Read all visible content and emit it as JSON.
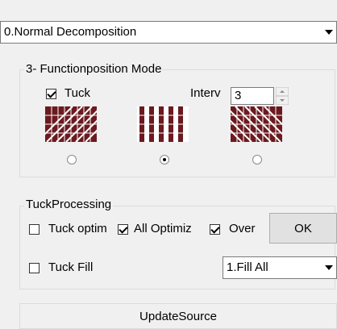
{
  "decomposition": {
    "selected": "0.Normal Decomposition"
  },
  "function_group": {
    "legend": "3- Functionposition Mode",
    "tuck_label": "Tuck",
    "tuck_checked": true,
    "interval_label": "Interv",
    "interval_value": "3",
    "patterns": [
      "diagonal-weave",
      "vertical-stripe",
      "reverse-diagonal-weave"
    ],
    "selected_pattern": 1,
    "pattern_color": "#6b1a1f"
  },
  "tuck_group": {
    "legend": "TuckProcessing",
    "tuck_optim_label": "Tuck optim",
    "tuck_optim_checked": false,
    "all_optimiz_label": "All Optimiz",
    "all_optimiz_checked": true,
    "over_label": "Over",
    "over_checked": true,
    "ok_label": "OK",
    "tuck_fill_label": "Tuck Fill",
    "tuck_fill_checked": false,
    "fill_selected": "1.Fill All"
  },
  "update_button": {
    "label": "UpdateSource"
  }
}
